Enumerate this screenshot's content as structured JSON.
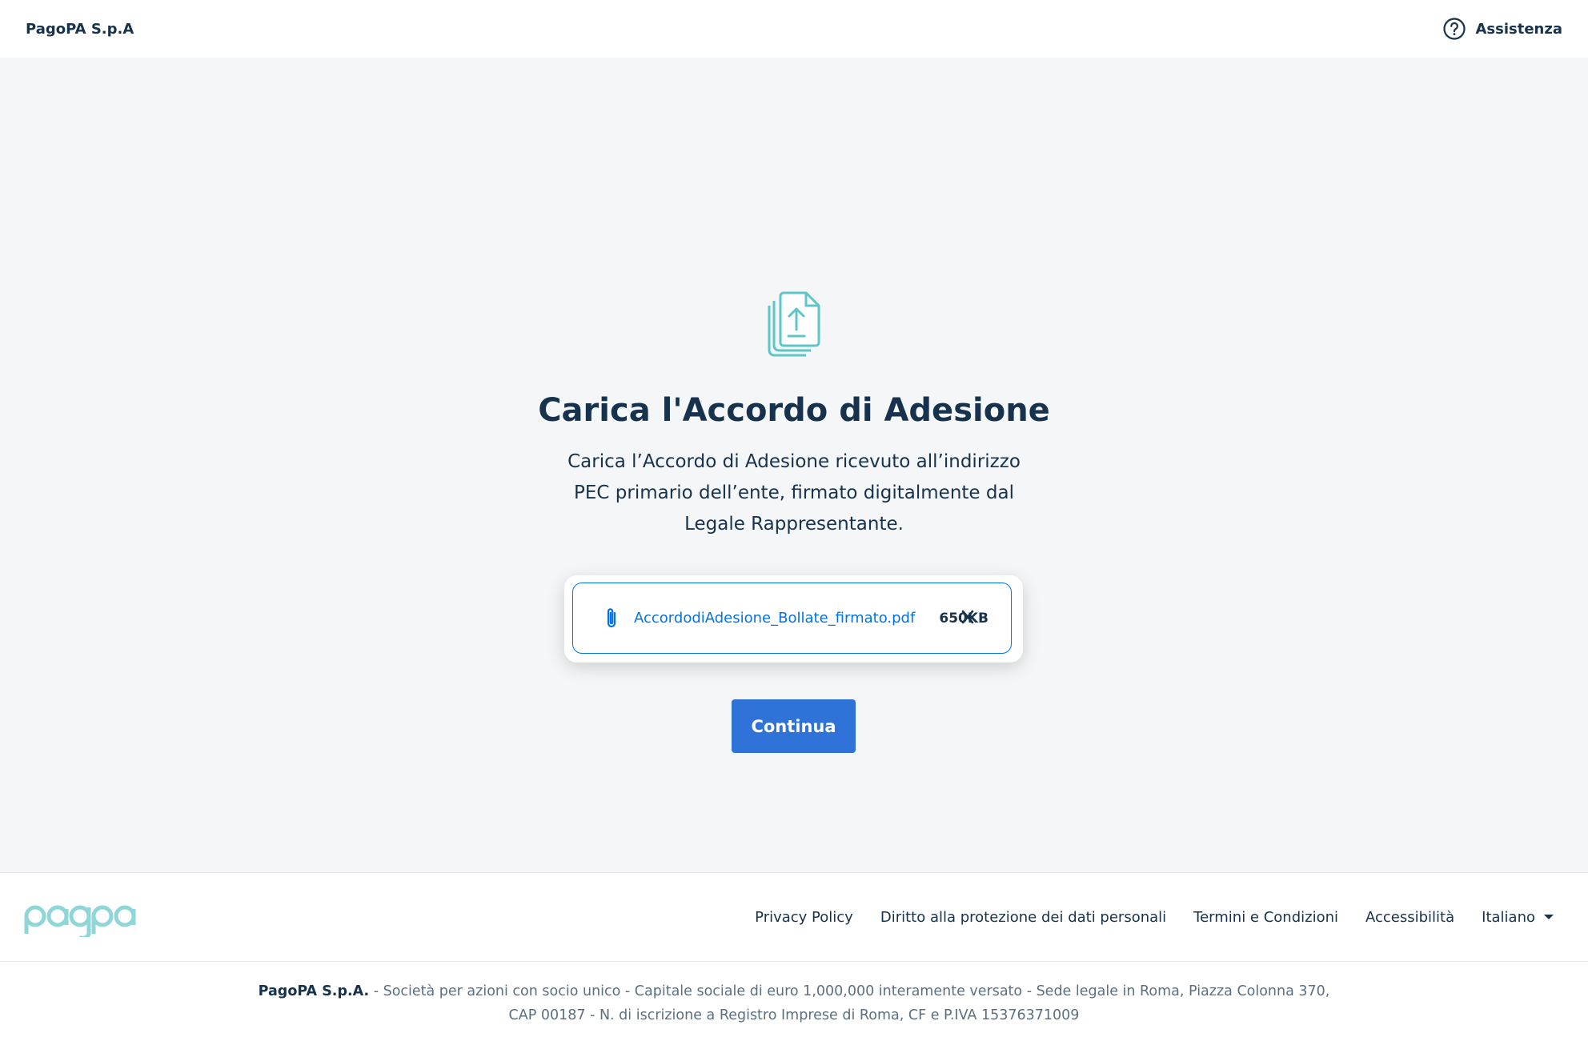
{
  "header": {
    "brand": "PagoPA S.p.A",
    "help_label": "Assistenza",
    "help_icon": "help-circle-icon"
  },
  "main": {
    "icon": "file-upload-icon",
    "title": "Carica l'Accordo di Adesione",
    "description": "Carica l’Accordo di Adesione ricevuto all’indirizzo PEC primario dell’ente, firmato digitalmente dal Legale Rappresentante.",
    "file": {
      "name": "AccordodiAdesione_Bollate_firmato.pdf",
      "size": "650KB",
      "icon": "paperclip-icon",
      "remove_icon": "close-icon"
    },
    "continue_label": "Continua"
  },
  "footer": {
    "logo_text": "pagopa",
    "links": [
      "Privacy Policy",
      "Diritto alla protezione dei dati personali",
      "Termini e Condizioni",
      "Accessibilità"
    ],
    "language": "Italiano",
    "legal_company": "PagoPA S.p.A.",
    "legal_line1": " - Società per azioni con socio unico - Capitale sociale di euro 1,000,000 interamente versato - Sede legale in Roma, Piazza Colonna 370,",
    "legal_line2": "CAP 00187 - N. di iscrizione a Registro Imprese di Roma, CF e P.IVA 15376371009"
  },
  "colors": {
    "primary": "#0073e6",
    "button": "#2f73d9",
    "text": "#17324d",
    "icon_teal": "#5ec5c8",
    "background": "#f5f6f7"
  }
}
